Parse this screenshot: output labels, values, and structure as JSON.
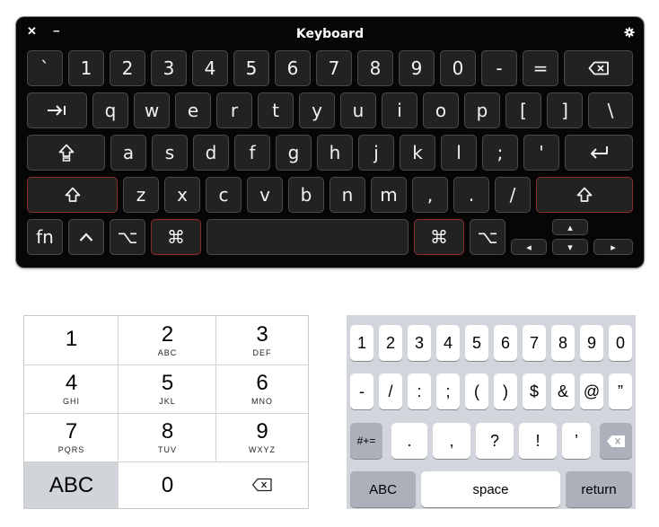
{
  "mac_keyboard": {
    "title": "Keyboard",
    "close_glyph": "✕",
    "minimize_glyph": "−",
    "keys": [
      {
        "id": "backtick",
        "label": "`"
      },
      {
        "id": "1",
        "label": "1"
      },
      {
        "id": "2",
        "label": "2"
      },
      {
        "id": "3",
        "label": "3"
      },
      {
        "id": "4",
        "label": "4"
      },
      {
        "id": "5",
        "label": "5"
      },
      {
        "id": "6",
        "label": "6"
      },
      {
        "id": "7",
        "label": "7"
      },
      {
        "id": "8",
        "label": "8"
      },
      {
        "id": "9",
        "label": "9"
      },
      {
        "id": "0",
        "label": "0"
      },
      {
        "id": "minus",
        "label": "-"
      },
      {
        "id": "equals",
        "label": "="
      },
      {
        "id": "delete",
        "label": "⌫"
      },
      {
        "id": "tab",
        "label": "⇥"
      },
      {
        "id": "q",
        "label": "q"
      },
      {
        "id": "w",
        "label": "w"
      },
      {
        "id": "e",
        "label": "e"
      },
      {
        "id": "r",
        "label": "r"
      },
      {
        "id": "t",
        "label": "t"
      },
      {
        "id": "y",
        "label": "y"
      },
      {
        "id": "u",
        "label": "u"
      },
      {
        "id": "i",
        "label": "i"
      },
      {
        "id": "o",
        "label": "o"
      },
      {
        "id": "p",
        "label": "p"
      },
      {
        "id": "lbracket",
        "label": "["
      },
      {
        "id": "rbracket",
        "label": "]"
      },
      {
        "id": "backslash",
        "label": "\\"
      },
      {
        "id": "capslock",
        "label": "⇪"
      },
      {
        "id": "a",
        "label": "a"
      },
      {
        "id": "s",
        "label": "s"
      },
      {
        "id": "d",
        "label": "d"
      },
      {
        "id": "f",
        "label": "f"
      },
      {
        "id": "g",
        "label": "g"
      },
      {
        "id": "h",
        "label": "h"
      },
      {
        "id": "j",
        "label": "j"
      },
      {
        "id": "k",
        "label": "k"
      },
      {
        "id": "l",
        "label": "l"
      },
      {
        "id": "semicolon",
        "label": ";"
      },
      {
        "id": "quote",
        "label": "'"
      },
      {
        "id": "return",
        "label": "↩"
      },
      {
        "id": "lshift",
        "label": "⇧"
      },
      {
        "id": "z",
        "label": "z"
      },
      {
        "id": "x",
        "label": "x"
      },
      {
        "id": "c",
        "label": "c"
      },
      {
        "id": "v",
        "label": "v"
      },
      {
        "id": "b",
        "label": "b"
      },
      {
        "id": "n",
        "label": "n"
      },
      {
        "id": "m",
        "label": "m"
      },
      {
        "id": "comma",
        "label": ","
      },
      {
        "id": "period",
        "label": "."
      },
      {
        "id": "slash",
        "label": "/"
      },
      {
        "id": "rshift",
        "label": "⇧"
      },
      {
        "id": "fn",
        "label": "fn"
      },
      {
        "id": "control",
        "label": "^"
      },
      {
        "id": "loption",
        "label": "⌥"
      },
      {
        "id": "lcommand",
        "label": "⌘"
      },
      {
        "id": "space",
        "label": ""
      },
      {
        "id": "rcommand",
        "label": "⌘"
      },
      {
        "id": "roption",
        "label": "⌥"
      },
      {
        "id": "left",
        "label": "◂"
      },
      {
        "id": "up",
        "label": "▴"
      },
      {
        "id": "down",
        "label": "▾"
      },
      {
        "id": "right",
        "label": "▸"
      }
    ]
  },
  "phone_pad": {
    "keys": [
      {
        "id": "1",
        "digit": "1",
        "letters": ""
      },
      {
        "id": "2",
        "digit": "2",
        "letters": "ABC"
      },
      {
        "id": "3",
        "digit": "3",
        "letters": "DEF"
      },
      {
        "id": "4",
        "digit": "4",
        "letters": "GHI"
      },
      {
        "id": "5",
        "digit": "5",
        "letters": "JKL"
      },
      {
        "id": "6",
        "digit": "6",
        "letters": "MNO"
      },
      {
        "id": "7",
        "digit": "7",
        "letters": "PQRS"
      },
      {
        "id": "8",
        "digit": "8",
        "letters": "TUV"
      },
      {
        "id": "9",
        "digit": "9",
        "letters": "WXYZ"
      },
      {
        "id": "abc",
        "digit": "ABC",
        "letters": ""
      },
      {
        "id": "0",
        "digit": "0",
        "letters": ""
      },
      {
        "id": "delete",
        "digit": "⌫",
        "letters": ""
      }
    ]
  },
  "ios_keyboard": {
    "keys": [
      {
        "id": "1",
        "label": "1"
      },
      {
        "id": "2",
        "label": "2"
      },
      {
        "id": "3",
        "label": "3"
      },
      {
        "id": "4",
        "label": "4"
      },
      {
        "id": "5",
        "label": "5"
      },
      {
        "id": "6",
        "label": "6"
      },
      {
        "id": "7",
        "label": "7"
      },
      {
        "id": "8",
        "label": "8"
      },
      {
        "id": "9",
        "label": "9"
      },
      {
        "id": "0",
        "label": "0"
      },
      {
        "id": "minus",
        "label": "-"
      },
      {
        "id": "slash",
        "label": "/"
      },
      {
        "id": "colon",
        "label": ":"
      },
      {
        "id": "semicolon",
        "label": ";"
      },
      {
        "id": "lparen",
        "label": "("
      },
      {
        "id": "rparen",
        "label": ")"
      },
      {
        "id": "dollar",
        "label": "$"
      },
      {
        "id": "ampersand",
        "label": "&"
      },
      {
        "id": "at",
        "label": "@"
      },
      {
        "id": "quote",
        "label": "”"
      },
      {
        "id": "symbols",
        "label": "#+="
      },
      {
        "id": "period",
        "label": "."
      },
      {
        "id": "comma",
        "label": ","
      },
      {
        "id": "question",
        "label": "?"
      },
      {
        "id": "exclaim",
        "label": "!"
      },
      {
        "id": "apostrophe",
        "label": "’"
      },
      {
        "id": "delete",
        "label": "⌫"
      },
      {
        "id": "abc",
        "label": "ABC"
      },
      {
        "id": "space",
        "label": "space"
      },
      {
        "id": "return",
        "label": "return"
      }
    ]
  },
  "colors": {
    "mac_bg": "#060606",
    "mac_key": "#222222",
    "mac_key_highlight_border": "#8d2d2d",
    "ios_bg": "#d2d5db",
    "ios_dark_key": "#abb0ba"
  }
}
